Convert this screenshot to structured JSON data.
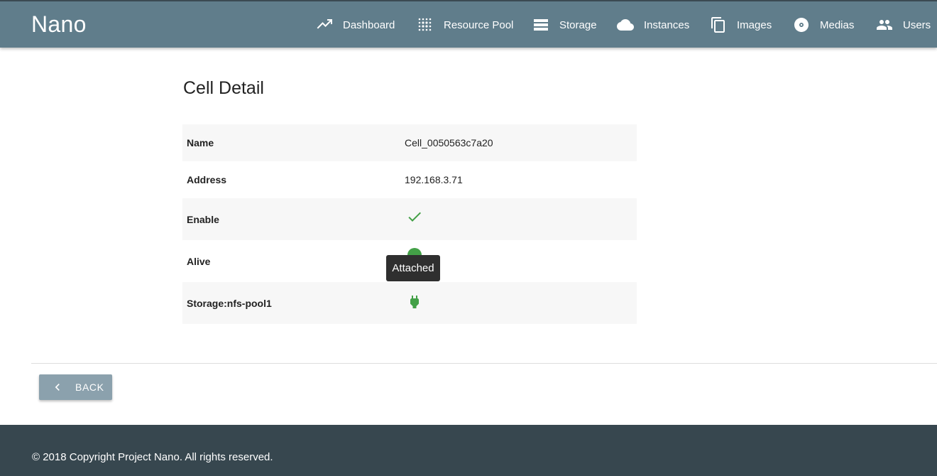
{
  "app": {
    "brand": "Nano"
  },
  "nav": {
    "items": [
      {
        "label": "Dashboard",
        "icon": "dashboard-icon"
      },
      {
        "label": "Resource Pool",
        "icon": "grain-icon"
      },
      {
        "label": "Storage",
        "icon": "storage-icon"
      },
      {
        "label": "Instances",
        "icon": "cloud-icon"
      },
      {
        "label": "Images",
        "icon": "copy-icon"
      },
      {
        "label": "Medias",
        "icon": "disc-icon"
      },
      {
        "label": "Users",
        "icon": "people-icon"
      }
    ]
  },
  "page": {
    "title": "Cell Detail"
  },
  "detail": {
    "rows": [
      {
        "key": "Name",
        "value": "Cell_0050563c7a20"
      },
      {
        "key": "Address",
        "value": "192.168.3.71"
      },
      {
        "key": "Enable",
        "icon": "check-icon"
      },
      {
        "key": "Alive",
        "icon": "status-dot-icon"
      },
      {
        "key": "Storage:nfs-pool1",
        "icon": "plug-icon"
      }
    ]
  },
  "tooltip": {
    "text": "Attached"
  },
  "actions": {
    "back_label": "BACK"
  },
  "footer": {
    "copyright": "© 2018 Copyright Project Nano. All rights reserved."
  },
  "colors": {
    "header": "#607d8b",
    "footer": "#37474f",
    "success": "#43a047",
    "back_button": "#8ba1ad"
  }
}
